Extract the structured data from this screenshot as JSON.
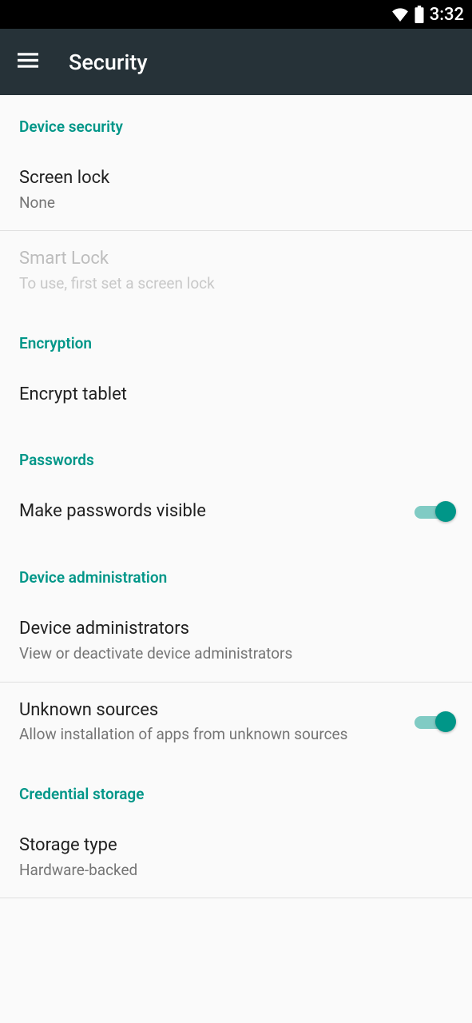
{
  "status": {
    "time": "3:32"
  },
  "header": {
    "title": "Security"
  },
  "sections": {
    "device_security": {
      "header": "Device security",
      "screen_lock": {
        "title": "Screen lock",
        "value": "None"
      },
      "smart_lock": {
        "title": "Smart Lock",
        "sub": "To use, first set a screen lock"
      }
    },
    "encryption": {
      "header": "Encryption",
      "encrypt_tablet": {
        "title": "Encrypt tablet"
      }
    },
    "passwords": {
      "header": "Passwords",
      "make_visible": {
        "title": "Make passwords visible",
        "toggled": true
      }
    },
    "device_admin": {
      "header": "Device administration",
      "administrators": {
        "title": "Device administrators",
        "sub": "View or deactivate device administrators"
      },
      "unknown_sources": {
        "title": "Unknown sources",
        "sub": "Allow installation of apps from unknown sources",
        "toggled": true
      }
    },
    "credential_storage": {
      "header": "Credential storage",
      "storage_type": {
        "title": "Storage type",
        "sub": "Hardware-backed"
      }
    }
  }
}
